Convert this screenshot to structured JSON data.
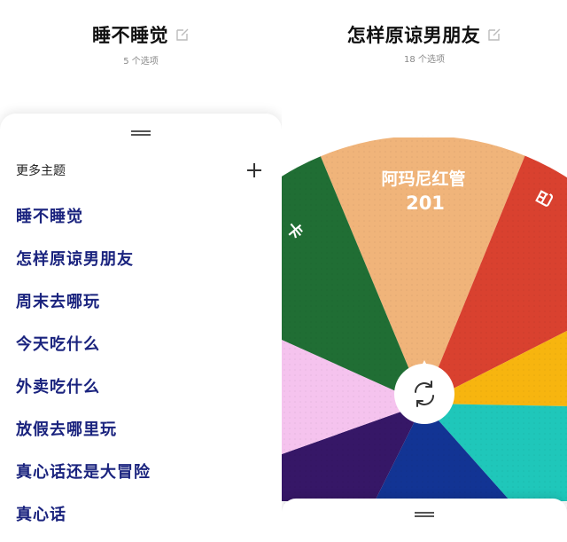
{
  "left": {
    "title": "睡不睡觉",
    "subtitle": "5 个选项",
    "sheet": {
      "header_label": "更多主题",
      "add_icon": "plus-icon",
      "themes": [
        "睡不睡觉",
        "怎样原谅男朋友",
        "周末去哪玩",
        "今天吃什么",
        "外卖吃什么",
        "放假去哪里玩",
        "真心话还是大冒险",
        "真心话"
      ]
    }
  },
  "right": {
    "title": "怎样原谅男朋友",
    "subtitle": "18 个选项",
    "wheel": {
      "option_count": 18,
      "top_label_line1": "阿玛尼红管",
      "top_label_line2": "201",
      "left_edge_glyph": "卡",
      "right_edge_glyph": "巴",
      "spin_icon": "refresh-icon",
      "colors": {
        "orange": "#f0b47a",
        "red": "#d9412f",
        "yellow": "#f7b50f",
        "teal": "#1fc7ba",
        "navy": "#123494",
        "purple": "#361767",
        "pink": "#f5c3ee",
        "green": "#206e34"
      }
    }
  },
  "icons": {
    "edit": "edit-icon",
    "handle": "drag-handle-icon"
  }
}
